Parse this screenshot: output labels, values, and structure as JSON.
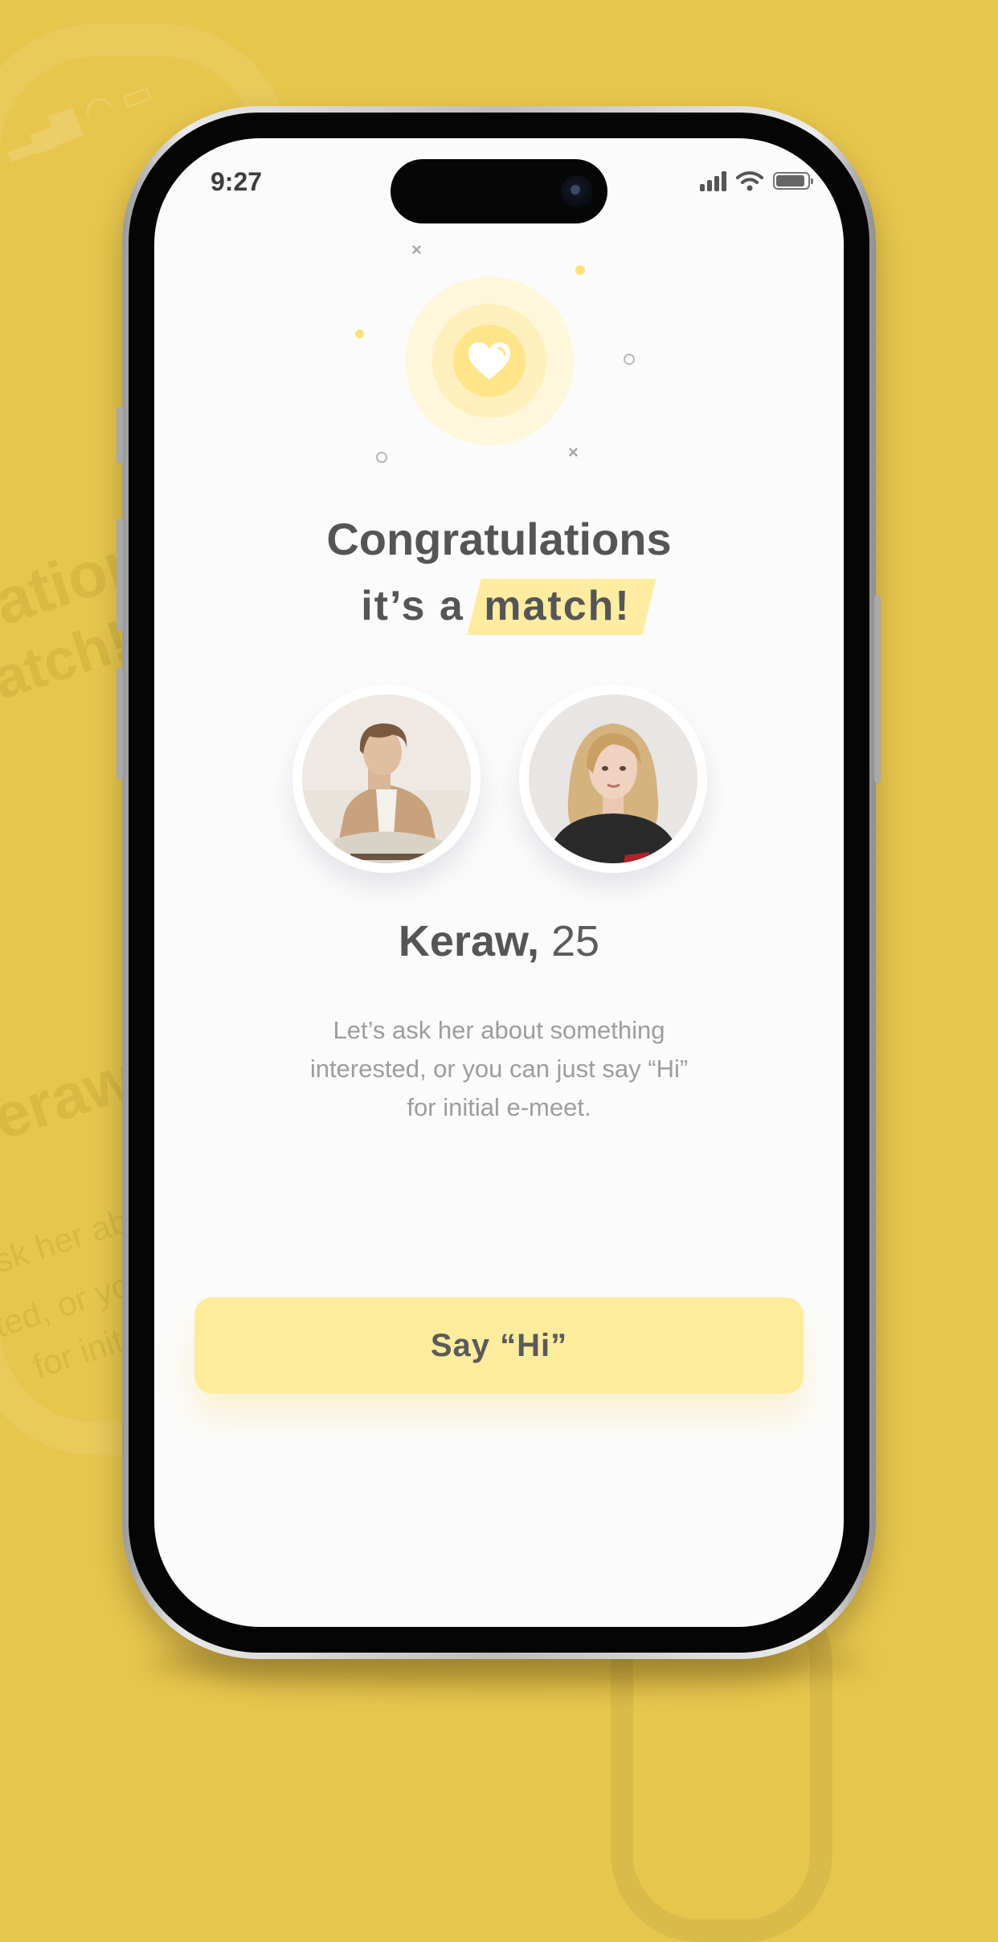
{
  "status_bar": {
    "time": "9:27"
  },
  "match": {
    "title": "Congratulations",
    "subtitle_prefix": "it’s a",
    "subtitle_highlight": "match!"
  },
  "profile": {
    "name": "Keraw,",
    "age": "25",
    "description_line1": "Let’s ask her about something",
    "description_line2": "interested, or you can just say “Hi”",
    "description_line3": "for initial e-meet."
  },
  "actions": {
    "say_hi_label": "Say “Hi”"
  },
  "colors": {
    "background": "#e8c64e",
    "accent": "#fdec9c",
    "heart": "#ffe58a"
  },
  "background_echo": {
    "line1": "ations",
    "line2": "atch!",
    "line3": "eraw",
    "line4": "sk her ab",
    "line5": "ted, or yo",
    "line6": "for init"
  },
  "icons": [
    "heart-icon",
    "signal-icon",
    "wifi-icon",
    "battery-icon"
  ]
}
